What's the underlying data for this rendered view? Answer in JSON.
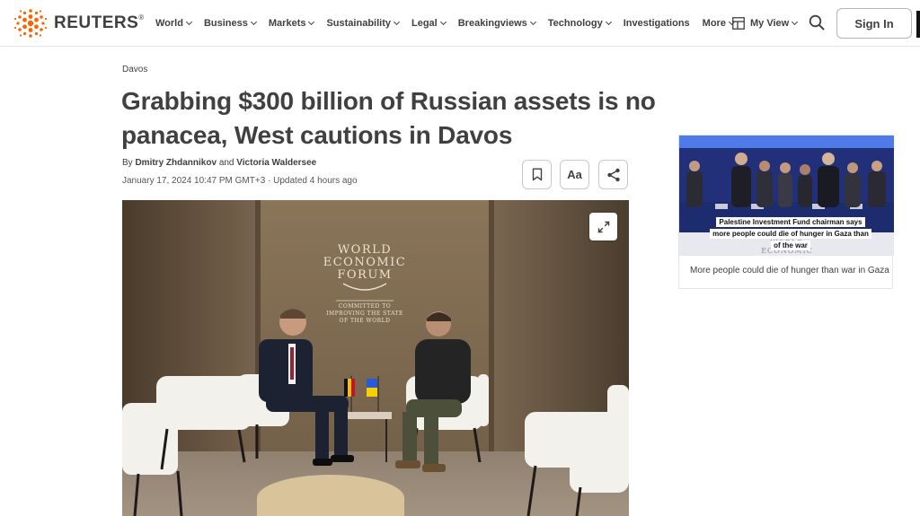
{
  "brand": {
    "name": "REUTERS",
    "mark": "®"
  },
  "nav": {
    "items": [
      {
        "label": "World",
        "dropdown": true
      },
      {
        "label": "Business",
        "dropdown": true
      },
      {
        "label": "Markets",
        "dropdown": true
      },
      {
        "label": "Sustainability",
        "dropdown": true
      },
      {
        "label": "Legal",
        "dropdown": true
      },
      {
        "label": "Breakingviews",
        "dropdown": true
      },
      {
        "label": "Technology",
        "dropdown": true
      },
      {
        "label": "Investigations",
        "dropdown": false
      },
      {
        "label": "More",
        "dropdown": true
      }
    ],
    "my_view": "My View",
    "sign_in": "Sign In"
  },
  "article": {
    "kicker": "Davos",
    "headline": "Grabbing $300 billion of Russian assets is no panacea, West cautions in Davos",
    "byline_prefix": "By",
    "author1": "Dmitry Zhdannikov",
    "byline_and": "and",
    "author2": "Victoria Waldersee",
    "dateline": "January 17, 2024 10:47 PM GMT+3 · Updated 4 hours ago",
    "text_size_label": "Aa",
    "photo": {
      "backdrop_line1": "WORLD",
      "backdrop_line2": "ECONOMIC",
      "backdrop_line3": "FORUM",
      "backdrop_sub1": "COMMITTED TO",
      "backdrop_sub2": "IMPROVING THE STATE",
      "backdrop_sub3": "OF THE WORLD"
    }
  },
  "side_video": {
    "caption": "Palestine Investment Fund chairman says more people could die of hunger in Gaza than of the war",
    "title": "More people could die of hunger than war in Gaza"
  },
  "colors": {
    "brand_orange": "#fa6400",
    "text": "#404040",
    "border": "#c9c9c9"
  }
}
